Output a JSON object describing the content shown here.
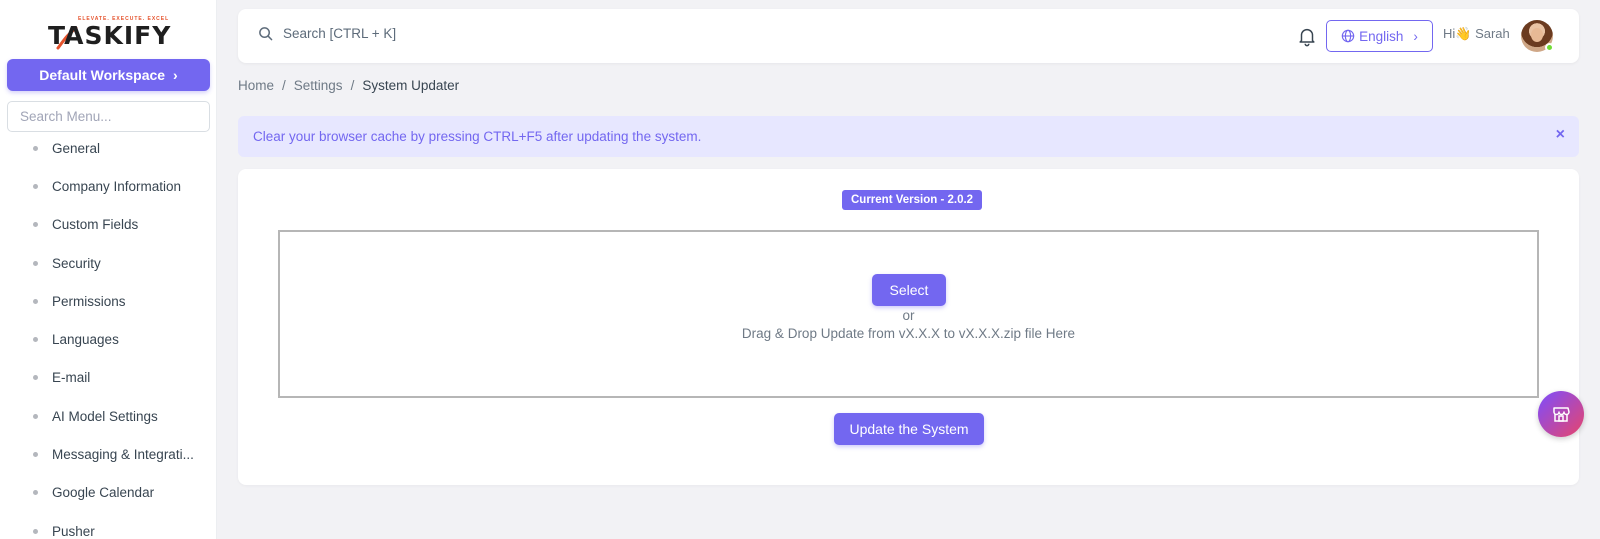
{
  "brand": {
    "name": "TASKIFY",
    "tagline": "ELEVATE. EXECUTE. EXCEL"
  },
  "sidebar": {
    "workspace_label": "Default Workspace",
    "search_placeholder": "Search Menu...",
    "items": [
      {
        "label": "General"
      },
      {
        "label": "Company Information"
      },
      {
        "label": "Custom Fields"
      },
      {
        "label": "Security"
      },
      {
        "label": "Permissions"
      },
      {
        "label": "Languages"
      },
      {
        "label": "E-mail"
      },
      {
        "label": "AI Model Settings"
      },
      {
        "label": "Messaging & Integrati..."
      },
      {
        "label": "Google Calendar"
      },
      {
        "label": "Pusher"
      }
    ]
  },
  "navbar": {
    "search_text": "Search [CTRL + K]",
    "language": "English",
    "greeting": "Hi👋 Sarah",
    "icons": {
      "search": "search-icon",
      "bell": "bell-icon",
      "globe": "globe-icon"
    }
  },
  "breadcrumb": {
    "home": "Home",
    "settings": "Settings",
    "current": "System Updater",
    "separator": "/"
  },
  "alert": {
    "message": "Clear your browser cache by pressing CTRL+F5 after updating the system.",
    "close": "×"
  },
  "updater": {
    "version_badge": "Current Version - 2.0.2",
    "select_label": "Select",
    "or_text": "or",
    "drop_text": "Drag & Drop Update from vX.X.X to vX.X.X.zip file Here",
    "update_label": "Update the System"
  },
  "colors": {
    "primary": "#7367f0",
    "alert_bg": "#e7e7ff",
    "page_bg": "#f2f2f5"
  }
}
